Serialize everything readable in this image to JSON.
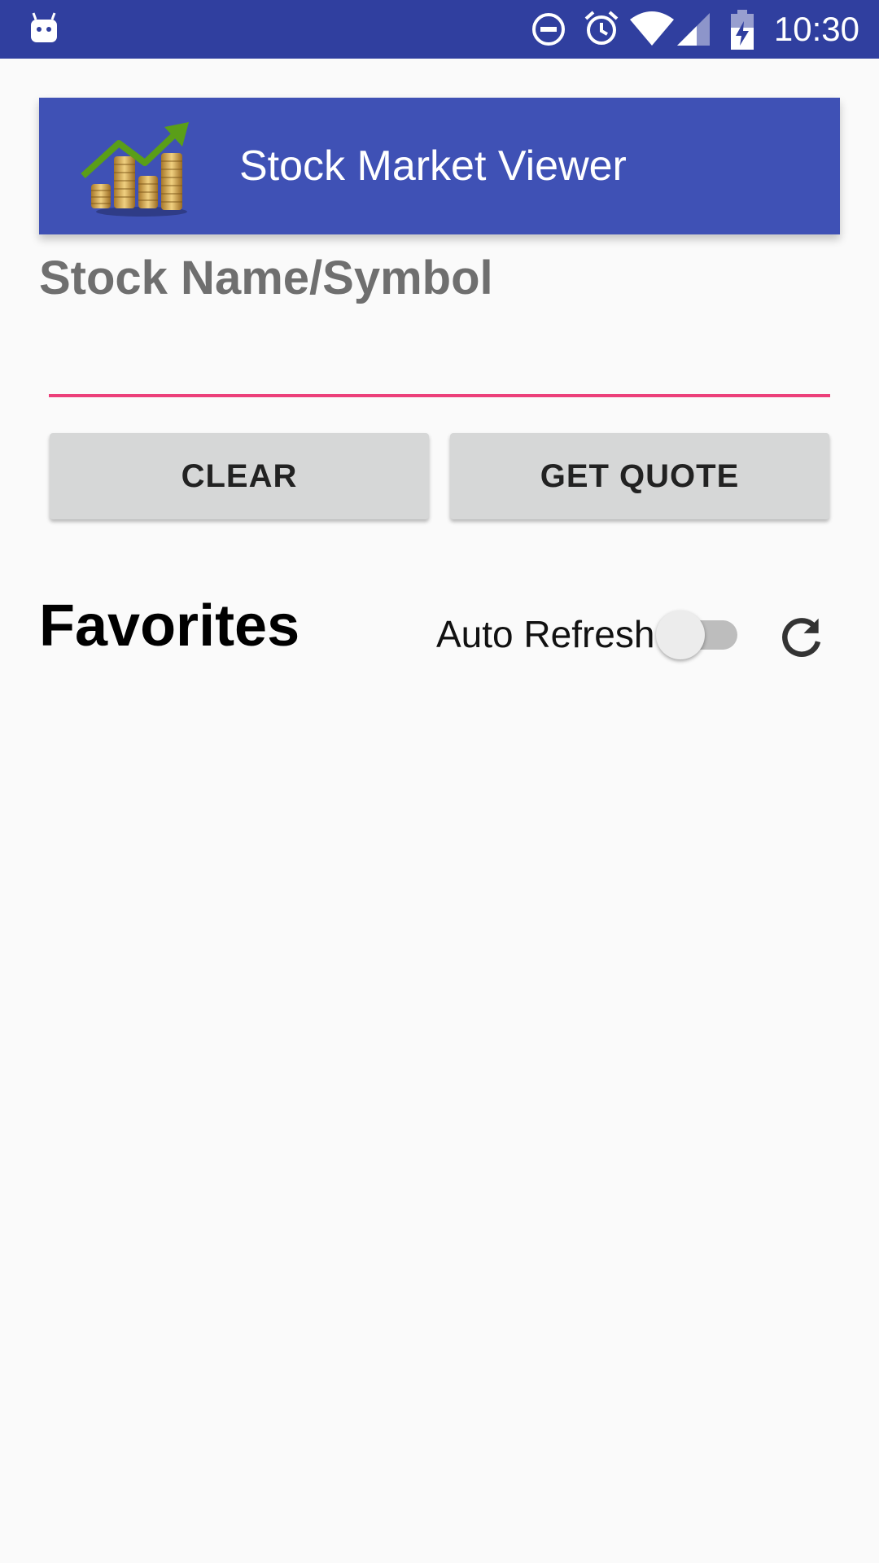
{
  "status_bar": {
    "time": "10:30",
    "icons": [
      "android-notification-icon",
      "do-not-disturb-icon",
      "alarm-icon",
      "wifi-icon",
      "cell-signal-icon",
      "battery-charging-icon"
    ]
  },
  "app": {
    "title": "Stock Market Viewer",
    "logo_icon": "stock-coins-chart-icon",
    "primary_color": "#3f51b5",
    "status_bar_color": "#303f9f",
    "accent_color": "#ec407a"
  },
  "search": {
    "label": "Stock Name/Symbol",
    "value": "",
    "placeholder": ""
  },
  "buttons": {
    "clear_label": "CLEAR",
    "get_quote_label": "GET QUOTE"
  },
  "favorites": {
    "title": "Favorites",
    "auto_refresh_label": "Auto Refresh",
    "auto_refresh_on": false,
    "refresh_icon": "refresh-icon",
    "items": []
  }
}
